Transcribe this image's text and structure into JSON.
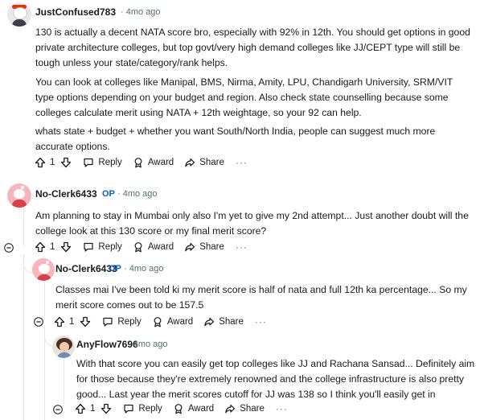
{
  "comments": [
    {
      "author": "JustConfused783",
      "op": "",
      "time": "4mo ago",
      "paragraphs": [
        "130 is actually a decent NATA score bro, especially with 92% in 12th. You should get options in good private architecture colleges, but top govt/very high demand colleges like JJ/CEPT type will still be tough unless your state/category/rank helps.",
        "You can look at colleges like Manipal, BMS, Nirma, Amity, LPU, Chandigarh University, SRM/VIT type options depending on your budget and region. Also check state counselling because some colleges calculate merit using NATA + 12th weightage, so your 92 can help.",
        "whats state + budget + whether you want South/North India, people can suggest much more accurate options."
      ],
      "votes": "1"
    },
    {
      "author": "No-Clerk6433",
      "op": "OP",
      "time": "4mo ago",
      "paragraphs": [
        "Am planning to stay in Mumbai only also I'm yet to give my 2nd attempt... Just another doubt will the college look at this 130 score or my final merit score?"
      ],
      "votes": "1"
    },
    {
      "author": "No-Clerk6433",
      "op": "OP",
      "time": "4mo ago",
      "paragraphs": [
        "Classes mai I've been told ki my merit score is half of nata and full 12th ka percentage... So my merit score comes out to be 157.5"
      ],
      "votes": "1"
    },
    {
      "author": "AnyFlow7696",
      "op": "",
      "time": "4mo ago",
      "paragraphs": [
        "With that score you can easily get top colleges like JJ and Rachana Sansad... Definitely aim for those because they're extremely renowned and the college infrastructure is also pretty good... Last year the merit scores cutoff for JJ was 138 so I think you'll easily get in"
      ],
      "votes": "1"
    }
  ],
  "actions": {
    "reply": "Reply",
    "award": "Award",
    "share": "Share",
    "more": "···",
    "separator": "·"
  },
  "icons": [
    "upvote-icon",
    "downvote-icon",
    "reply-icon",
    "award-icon",
    "share-icon",
    "collapse-icon"
  ],
  "colors": {
    "op": "#0a5fc7",
    "meta": "#576f76",
    "thread_line": "#e3e5e8"
  }
}
